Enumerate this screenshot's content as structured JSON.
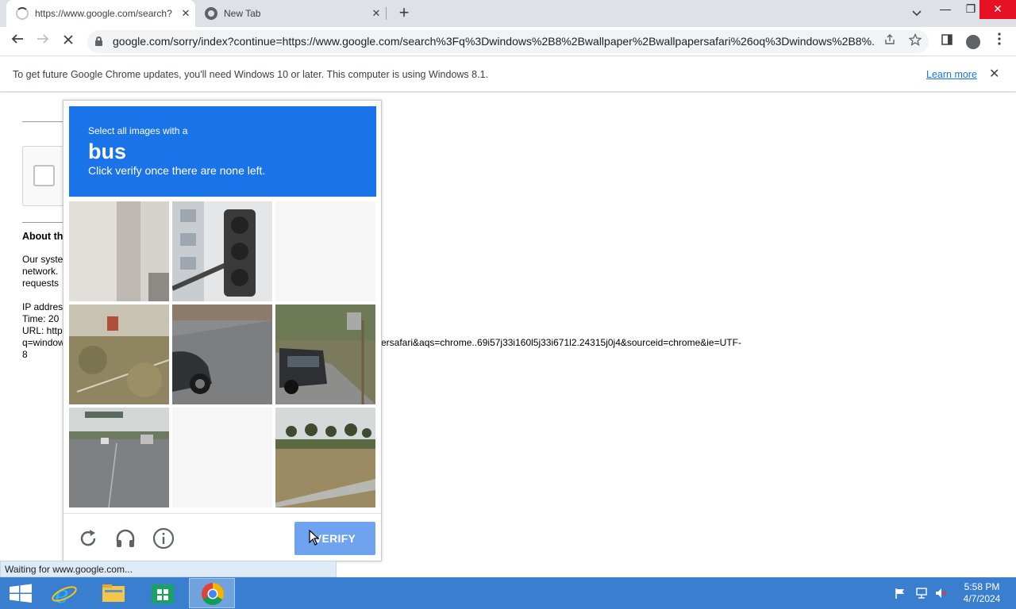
{
  "browser": {
    "tabs": [
      {
        "title": "https://www.google.com/search?",
        "close": "✕"
      },
      {
        "title": "New Tab",
        "close": "✕"
      }
    ],
    "new_tab": "+",
    "tab_search": "⌄",
    "window_controls": {
      "minimize": "—",
      "restore": "❐",
      "close": "✕"
    },
    "url": "google.com/sorry/index?continue=https://www.google.com/search%3Fq%3Dwindows%2B8%2Bwallpaper%2Bwallpapersafari%26oq%3Dwindows%2B8%..."
  },
  "infobar": {
    "message": "To get future Google Chrome updates, you'll need Windows 10 or later. This computer is using Windows 8.1.",
    "learn_more": "Learn more",
    "close": "✕"
  },
  "page": {
    "about_heading": "About th",
    "para_lines": "Our syste\nnetwork.\nrequests",
    "ip_lines": "IP addres\nTime: 20\nURL: http\nq=window\n8",
    "url_tail": "ersafari&aqs=chrome..69i57j33i160l5j33i671l2.24315j0j4&sourceid=chrome&ie=UTF-"
  },
  "captcha": {
    "instruction_line1": "Select all images with a",
    "target": "bus",
    "instruction_line2": "Click verify once there are none left.",
    "tiles": [
      "pillar",
      "traffic-light",
      "blank",
      "overgrown-sign",
      "car-on-road",
      "suv-parked",
      "highway",
      "blank",
      "palm-trees-field"
    ],
    "verify_label": "VERIFY"
  },
  "status_bar": "Waiting for www.google.com...",
  "taskbar": {
    "time": "5:58 PM",
    "date": "4/7/2024"
  },
  "colors": {
    "captcha_blue": "#1a73e8",
    "verify_button": "#6fa2ef",
    "taskbar": "#3a7ed0"
  }
}
